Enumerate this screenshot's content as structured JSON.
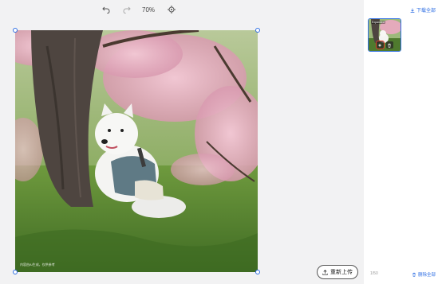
{
  "toolbar": {
    "undo_icon": "undo-icon",
    "redo_icon": "redo-icon",
    "zoom": "70%",
    "fit_icon": "fit-target-icon"
  },
  "canvas": {
    "image_alt": "Samoyed dog sitting in grass under blooming cherry tree",
    "watermark": "内容由AI生成，仅供参考"
  },
  "actions": {
    "reupload_label": "重新上传"
  },
  "panel": {
    "download_all_label": "下载全部",
    "thumb_badge": "Expanded",
    "counter": "1/50",
    "delete_all_label": "删除全部"
  },
  "colors": {
    "accent": "#2f6fe4",
    "highlight": "#e0402a",
    "background": "#f2f2f3"
  }
}
